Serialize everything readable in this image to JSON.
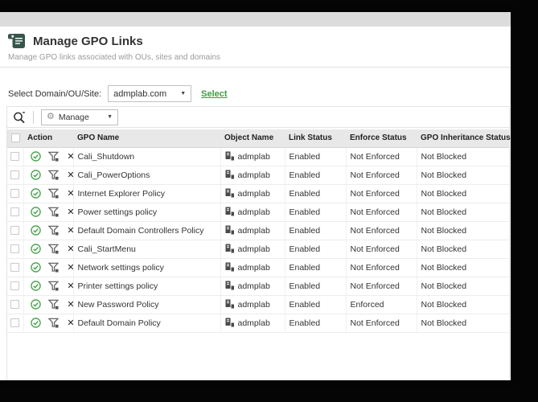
{
  "page": {
    "title": "Manage GPO Links",
    "subtitle": "Manage GPO links associated with OUs, sites and domains"
  },
  "domain_selector": {
    "label": "Select Domain/OU/Site:",
    "value": "admplab.com",
    "action_link": "Select"
  },
  "toolbar": {
    "manage_dropdown_label": "Manage"
  },
  "table": {
    "headers": [
      "Action",
      "GPO Name",
      "Object Name",
      "Link Status",
      "Enforce Status",
      "GPO Inheritance Status"
    ],
    "rows": [
      {
        "gpo_name": "Cali_Shutdown",
        "object_name": "admplab",
        "link_status": "Enabled",
        "enforce_status": "Not Enforced",
        "inheritance_status": "Not Blocked"
      },
      {
        "gpo_name": "Cali_PowerOptions",
        "object_name": "admplab",
        "link_status": "Enabled",
        "enforce_status": "Not Enforced",
        "inheritance_status": "Not Blocked"
      },
      {
        "gpo_name": "Internet Explorer Policy",
        "object_name": "admplab",
        "link_status": "Enabled",
        "enforce_status": "Not Enforced",
        "inheritance_status": "Not Blocked"
      },
      {
        "gpo_name": "Power settings policy",
        "object_name": "admplab",
        "link_status": "Enabled",
        "enforce_status": "Not Enforced",
        "inheritance_status": "Not Blocked"
      },
      {
        "gpo_name": "Default Domain Controllers Policy",
        "object_name": "admplab",
        "link_status": "Enabled",
        "enforce_status": "Not Enforced",
        "inheritance_status": "Not Blocked"
      },
      {
        "gpo_name": "Cali_StartMenu",
        "object_name": "admplab",
        "link_status": "Enabled",
        "enforce_status": "Not Enforced",
        "inheritance_status": "Not Blocked"
      },
      {
        "gpo_name": "Network settings policy",
        "object_name": "admplab",
        "link_status": "Enabled",
        "enforce_status": "Not Enforced",
        "inheritance_status": "Not Blocked"
      },
      {
        "gpo_name": "Printer settings policy",
        "object_name": "admplab",
        "link_status": "Enabled",
        "enforce_status": "Not Enforced",
        "inheritance_status": "Not Blocked"
      },
      {
        "gpo_name": "New Password Policy",
        "object_name": "admplab",
        "link_status": "Enabled",
        "enforce_status": "Enforced",
        "inheritance_status": "Not Blocked"
      },
      {
        "gpo_name": "Default Domain Policy",
        "object_name": "admplab",
        "link_status": "Enabled",
        "enforce_status": "Not Enforced",
        "inheritance_status": "Not Blocked"
      }
    ]
  },
  "icons": {
    "gear": "⚙",
    "caret": "▼",
    "remove": "✕"
  },
  "colors": {
    "accent_green": "#3d9c44",
    "check_green": "#43a047",
    "header_icon_color": "#35564c",
    "table_header_bg": "#e8e8e8"
  }
}
